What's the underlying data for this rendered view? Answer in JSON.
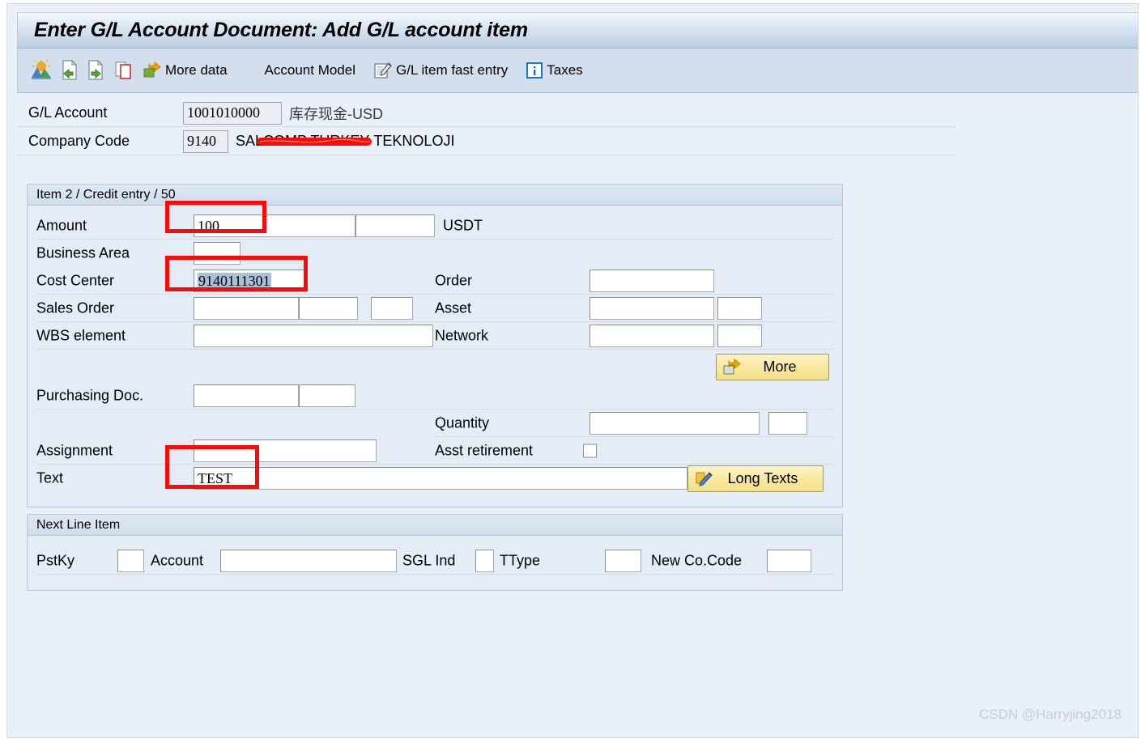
{
  "window": {
    "title": "Enter G/L Account Document: Add G/L account item"
  },
  "toolbar": {
    "icons": [
      {
        "name": "account-model-icon",
        "label": ""
      },
      {
        "name": "document-back-icon",
        "label": ""
      },
      {
        "name": "document-forward-icon",
        "label": ""
      },
      {
        "name": "copy-pages-icon",
        "label": ""
      }
    ],
    "more_data_label": "More data",
    "more_data_icon": "arrow-out-icon",
    "account_model_label": "Account Model",
    "fast_entry_label": "G/L item fast entry",
    "fast_entry_icon": "document-pen-icon",
    "taxes_label": "Taxes",
    "taxes_icon": "info-icon"
  },
  "header": {
    "gl_account_label": "G/L Account",
    "gl_account_value": "1001010000",
    "gl_account_desc": "库存现金-USD",
    "company_code_label": "Company Code",
    "company_code_value": "9140",
    "company_name_prefix": "SAL",
    "company_name_redacted": "COMP TURKEY",
    "company_name_suffix": "TEKNOLOJI"
  },
  "item_panel": {
    "header": "Item 2 / Credit entry / 50",
    "rows": {
      "amount_label": "Amount",
      "amount_value": "100",
      "amount_currency": "USDT",
      "business_area_label": "Business Area",
      "business_area_value": "",
      "cost_center_label": "Cost Center",
      "cost_center_value": "9140111301",
      "order_label": "Order",
      "order_value": "",
      "sales_order_label": "Sales Order",
      "sales_order_value": "",
      "asset_label": "Asset",
      "asset_value": "",
      "wbs_label": "WBS element",
      "wbs_value": "",
      "network_label": "Network",
      "network_value": "",
      "more_button_label": "More",
      "more_button_icon": "arrow-out-icon",
      "purchasing_doc_label": "Purchasing Doc.",
      "purchasing_doc_value": "",
      "quantity_label": "Quantity",
      "quantity_value": "",
      "assignment_label": "Assignment",
      "assignment_value": "",
      "asst_retirement_label": "Asst retirement",
      "text_label": "Text",
      "text_value": "TEST",
      "long_texts_label": "Long Texts",
      "long_texts_icon": "pencil-note-icon"
    }
  },
  "next_line_item": {
    "header": "Next Line Item",
    "pstky_label": "PstKy",
    "pstky_value": "",
    "account_label": "Account",
    "account_value": "",
    "sgl_ind_label": "SGL Ind",
    "sgl_ind_value": "",
    "ttype_label": "TType",
    "ttype_value": "",
    "new_cocode_label": "New Co.Code",
    "new_cocode_value": ""
  },
  "watermark": "CSDN @Harryjing2018",
  "colors": {
    "annotation_red": "#fb0a0a",
    "title_blue": "#b9cde2",
    "panel_bg": "#e4edf6",
    "body_bg": "#e9f0f8",
    "button_yellow": "#f5e08a",
    "selection_blue": "#a8c0d8"
  }
}
